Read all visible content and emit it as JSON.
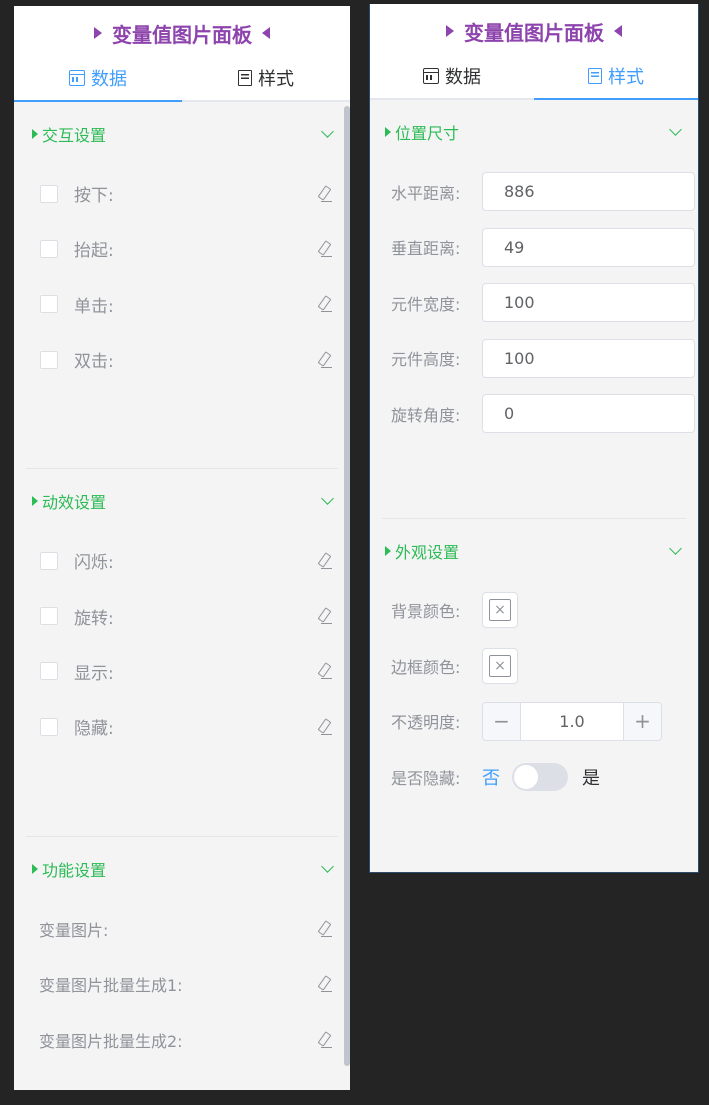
{
  "left_panel": {
    "title": "变量值图片面板",
    "tabs": [
      {
        "label": "数据"
      },
      {
        "label": "样式"
      }
    ],
    "sections": {
      "interaction": {
        "title": "交互设置",
        "items": [
          {
            "label": "按下:"
          },
          {
            "label": "抬起:"
          },
          {
            "label": "单击:"
          },
          {
            "label": "双击:"
          }
        ]
      },
      "animation": {
        "title": "动效设置",
        "items": [
          {
            "label": "闪烁:"
          },
          {
            "label": "旋转:"
          },
          {
            "label": "显示:"
          },
          {
            "label": "隐藏:"
          }
        ]
      },
      "function": {
        "title": "功能设置",
        "items": [
          {
            "label": "变量图片:"
          },
          {
            "label": "变量图片批量生成1:"
          },
          {
            "label": "变量图片批量生成2:"
          }
        ]
      }
    }
  },
  "right_panel": {
    "title": "变量值图片面板",
    "tabs": [
      {
        "label": "数据"
      },
      {
        "label": "样式"
      }
    ],
    "position": {
      "title": "位置尺寸",
      "fields": [
        {
          "label": "水平距离:",
          "value": "886"
        },
        {
          "label": "垂直距离:",
          "value": "49"
        },
        {
          "label": "元件宽度:",
          "value": "100"
        },
        {
          "label": "元件高度:",
          "value": "100"
        },
        {
          "label": "旋转角度:",
          "value": "0"
        }
      ]
    },
    "appearance": {
      "title": "外观设置",
      "bg_color_label": "背景颜色:",
      "border_color_label": "边框颜色:",
      "swatch_symbol": "×",
      "opacity_label": "不透明度:",
      "opacity_minus": "−",
      "opacity_value": "1.0",
      "opacity_plus": "+",
      "hidden_label": "是否隐藏:",
      "hidden_off": "否",
      "hidden_on": "是",
      "hidden_state": false
    }
  },
  "colors": {
    "title_purple": "#8e44ad",
    "section_green": "#2dbb55",
    "tab_active_blue": "#409eff",
    "app_background": "#242424",
    "panel_background": "#f4f4f5"
  }
}
